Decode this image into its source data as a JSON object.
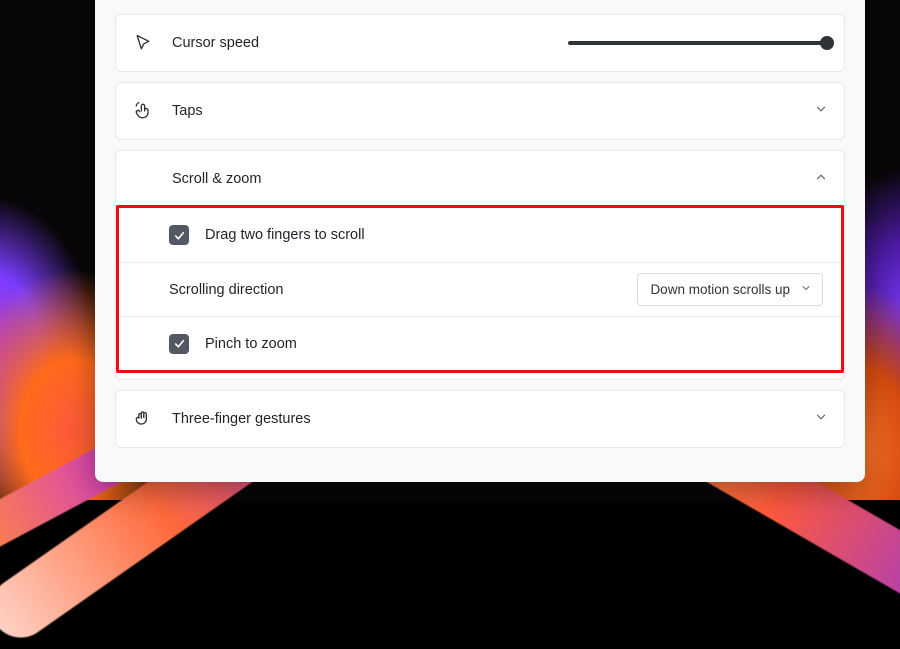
{
  "cursor_speed": {
    "label": "Cursor speed",
    "value": 100
  },
  "taps": {
    "label": "Taps"
  },
  "scroll_zoom": {
    "label": "Scroll & zoom",
    "drag_two_fingers": {
      "label": "Drag two fingers to scroll",
      "checked": true
    },
    "direction": {
      "label": "Scrolling direction",
      "selected": "Down motion scrolls up"
    },
    "pinch_zoom": {
      "label": "Pinch to zoom",
      "checked": true
    }
  },
  "three_finger": {
    "label": "Three-finger gestures"
  }
}
